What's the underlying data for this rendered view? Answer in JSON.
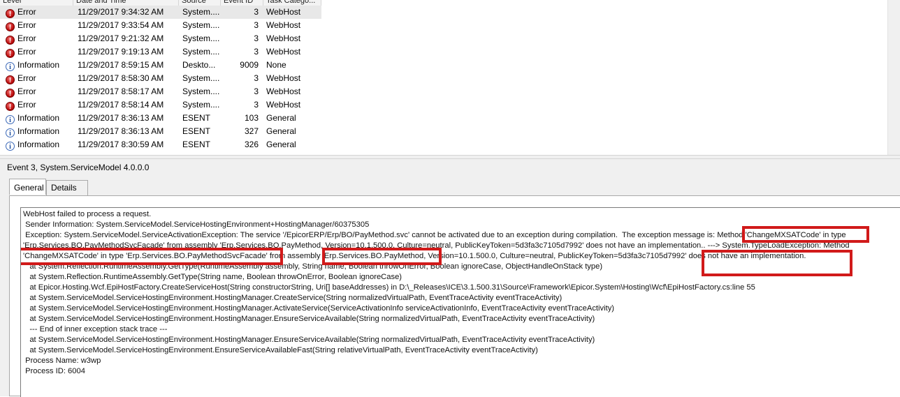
{
  "event_list": {
    "columns": [
      "Level",
      "Date and Time",
      "Source",
      "Event ID",
      "Task Catego..."
    ],
    "rows": [
      {
        "level": "Error",
        "icon": "error-icon",
        "datetime": "11/29/2017 9:34:32 AM",
        "source": "System....",
        "event_id": "3",
        "task": "WebHost"
      },
      {
        "level": "Error",
        "icon": "error-icon",
        "datetime": "11/29/2017 9:33:54 AM",
        "source": "System....",
        "event_id": "3",
        "task": "WebHost"
      },
      {
        "level": "Error",
        "icon": "error-icon",
        "datetime": "11/29/2017 9:21:32 AM",
        "source": "System....",
        "event_id": "3",
        "task": "WebHost"
      },
      {
        "level": "Error",
        "icon": "error-icon",
        "datetime": "11/29/2017 9:19:13 AM",
        "source": "System....",
        "event_id": "3",
        "task": "WebHost"
      },
      {
        "level": "Information",
        "icon": "info-icon",
        "datetime": "11/29/2017 8:59:15 AM",
        "source": "Deskto...",
        "event_id": "9009",
        "task": "None"
      },
      {
        "level": "Error",
        "icon": "error-icon",
        "datetime": "11/29/2017 8:58:30 AM",
        "source": "System....",
        "event_id": "3",
        "task": "WebHost"
      },
      {
        "level": "Error",
        "icon": "error-icon",
        "datetime": "11/29/2017 8:58:17 AM",
        "source": "System....",
        "event_id": "3",
        "task": "WebHost"
      },
      {
        "level": "Error",
        "icon": "error-icon",
        "datetime": "11/29/2017 8:58:14 AM",
        "source": "System....",
        "event_id": "3",
        "task": "WebHost"
      },
      {
        "level": "Information",
        "icon": "info-icon",
        "datetime": "11/29/2017 8:36:13 AM",
        "source": "ESENT",
        "event_id": "103",
        "task": "General"
      },
      {
        "level": "Information",
        "icon": "info-icon",
        "datetime": "11/29/2017 8:36:13 AM",
        "source": "ESENT",
        "event_id": "327",
        "task": "General"
      },
      {
        "level": "Information",
        "icon": "info-icon",
        "datetime": "11/29/2017 8:30:59 AM",
        "source": "ESENT",
        "event_id": "326",
        "task": "General"
      }
    ]
  },
  "detail": {
    "title": "Event 3, System.ServiceModel 4.0.0.0",
    "tabs": [
      "General",
      "Details"
    ],
    "lines": [
      "WebHost failed to process a request.",
      " Sender Information: System.ServiceModel.ServiceHostingEnvironment+HostingManager/60375305",
      " Exception: System.ServiceModel.ServiceActivationException: The service '/EpicorERP/Erp/BO/PayMethod.svc' cannot be activated due to an exception during compilation.  The exception message is: Method 'ChangeMXSATCode' in type",
      "'Erp.Services.BO.PayMethodSvcFacade' from assembly 'Erp.Services.BO.PayMethod, Version=10.1.500.0, Culture=neutral, PublicKeyToken=5d3fa3c7105d7992' does not have an implementation.. ---> System.TypeLoadException: Method",
      "'ChangeMXSATCode' in type 'Erp.Services.BO.PayMethodSvcFacade' from assembly 'Erp.Services.BO.PayMethod, Version=10.1.500.0, Culture=neutral, PublicKeyToken=5d3fa3c7105d7992' does not have an implementation.",
      "   at System.Reflection.RuntimeAssembly.GetType(RuntimeAssembly assembly, String name, Boolean throwOnError, Boolean ignoreCase, ObjectHandleOnStack type)",
      "   at System.Reflection.RuntimeAssembly.GetType(String name, Boolean throwOnError, Boolean ignoreCase)",
      "   at Epicor.Hosting.Wcf.EpiHostFactory.CreateServiceHost(String constructorString, Uri[] baseAddresses) in D:\\_Releases\\ICE\\3.1.500.31\\Source\\Framework\\Epicor.System\\Hosting\\Wcf\\EpiHostFactory.cs:line 55",
      "   at System.ServiceModel.ServiceHostingEnvironment.HostingManager.CreateService(String normalizedVirtualPath, EventTraceActivity eventTraceActivity)",
      "   at System.ServiceModel.ServiceHostingEnvironment.HostingManager.ActivateService(ServiceActivationInfo serviceActivationInfo, EventTraceActivity eventTraceActivity)",
      "   at System.ServiceModel.ServiceHostingEnvironment.HostingManager.EnsureServiceAvailable(String normalizedVirtualPath, EventTraceActivity eventTraceActivity)",
      "   --- End of inner exception stack trace ---",
      "   at System.ServiceModel.ServiceHostingEnvironment.HostingManager.EnsureServiceAvailable(String normalizedVirtualPath, EventTraceActivity eventTraceActivity)",
      "   at System.ServiceModel.ServiceHostingEnvironment.EnsureServiceAvailableFast(String relativeVirtualPath, EventTraceActivity eventTraceActivity)",
      " Process Name: w3wp",
      " Process ID: 6004"
    ]
  },
  "colors": {
    "highlight": "#d11a1a",
    "error": "#c01010",
    "info": "#1f4fa0"
  }
}
